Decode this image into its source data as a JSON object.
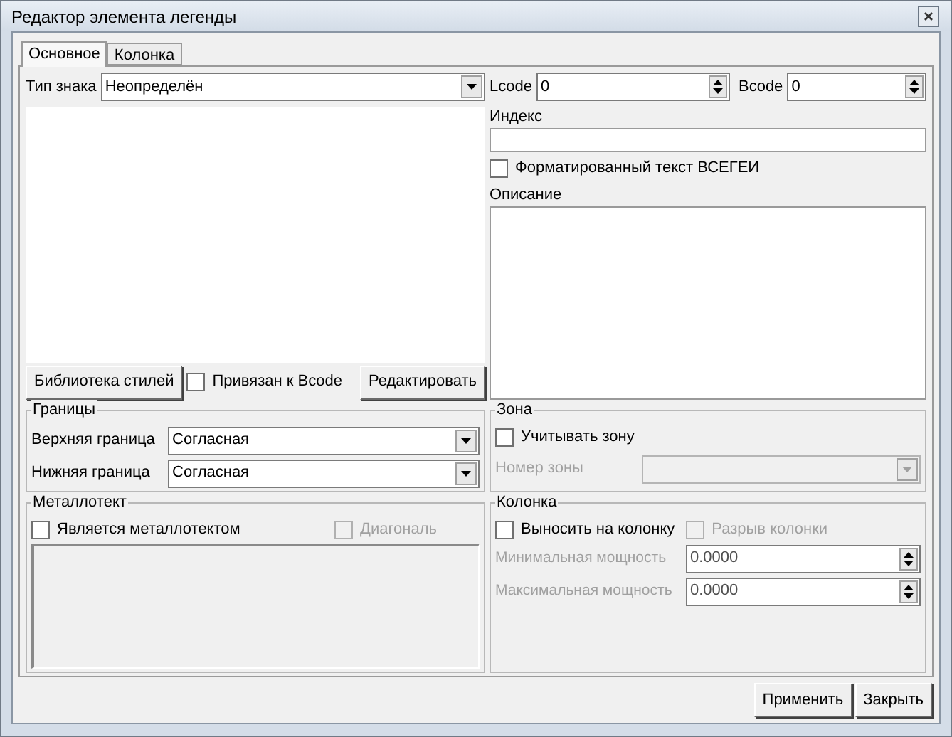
{
  "window": {
    "title": "Редактор элемента легенды"
  },
  "tabs": [
    {
      "label": "Основное",
      "selected": true
    },
    {
      "label": "Колонка",
      "selected": false
    }
  ],
  "main": {
    "sign_type": {
      "label": "Тип знака",
      "value": "Неопределён"
    },
    "lcode": {
      "label": "Lcode",
      "value": "0"
    },
    "bcode": {
      "label": "Bcode",
      "value": "0"
    },
    "index": {
      "label": "Индекс"
    },
    "formatted_text": {
      "label": "Форматированный текст ВСЕГЕИ",
      "checked": false
    },
    "description": {
      "label": "Описание"
    },
    "style_library_button": "Библиотека стилей",
    "bound_to_bcode": {
      "label": "Привязан к Bcode",
      "checked": false
    },
    "edit_button": "Редактировать"
  },
  "boundaries": {
    "title": "Границы",
    "fields": [
      {
        "label": "Верхняя граница",
        "value": "Согласная"
      },
      {
        "label": "Нижняя граница",
        "value": "Согласная"
      }
    ]
  },
  "zone": {
    "title": "Зона",
    "use_zone": {
      "label": "Учитывать зону",
      "checked": false
    },
    "zone_number": {
      "label": "Номер зоны",
      "disabled": true
    }
  },
  "metallotect": {
    "title": "Металлотект",
    "is_metallotect": {
      "label": "Является металлотектом",
      "checked": false,
      "disabled": false
    },
    "diagonal": {
      "label": "Диагональ",
      "checked": false,
      "disabled": true
    }
  },
  "column": {
    "title": "Колонка",
    "place_on_column": {
      "label": "Выносить на колонку",
      "checked": false,
      "disabled": false
    },
    "column_break": {
      "label": "Разрыв колонки",
      "checked": false,
      "disabled": true
    },
    "min_thickness": {
      "label": "Минимальная мощность",
      "value": "0.0000",
      "disabled": true
    },
    "max_thickness": {
      "label": "Максимальная мощность",
      "value": "0.0000",
      "disabled": true
    }
  },
  "buttons": [
    "Применить",
    "Закрыть"
  ]
}
